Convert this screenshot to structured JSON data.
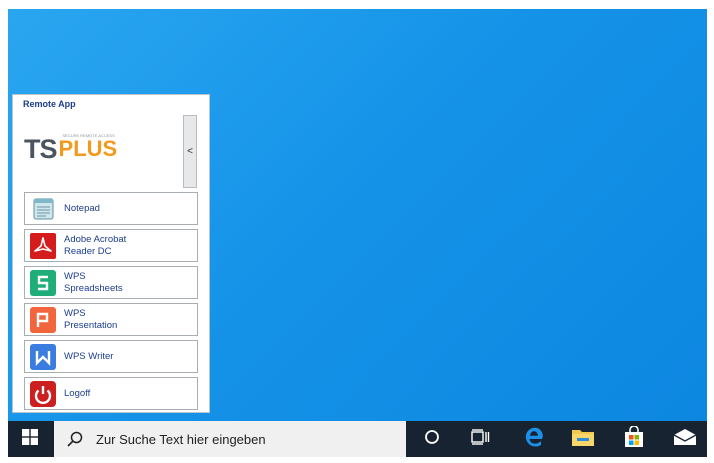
{
  "panel": {
    "title": "Remote App",
    "logo": {
      "ts": "TS",
      "plus": "PLUS",
      "tagline": "SECURE REMOTE ACCESS"
    },
    "collapse_label": "<",
    "apps": [
      {
        "line1": "Notepad",
        "line2": "",
        "icon": "notepad-icon"
      },
      {
        "line1": "Adobe Acrobat",
        "line2": "Reader DC",
        "icon": "adobe-acrobat-icon"
      },
      {
        "line1": "WPS",
        "line2": "Spreadsheets",
        "icon": "wps-spreadsheets-icon"
      },
      {
        "line1": "WPS",
        "line2": "Presentation",
        "icon": "wps-presentation-icon"
      },
      {
        "line1": "WPS Writer",
        "line2": "",
        "icon": "wps-writer-icon"
      },
      {
        "line1": "Logoff",
        "line2": "",
        "icon": "logoff-icon"
      }
    ]
  },
  "taskbar": {
    "search_placeholder": "Zur Suche Text hier eingeben",
    "icons": [
      "windows-start-icon",
      "search-icon",
      "cortana-icon",
      "task-view-icon",
      "edge-icon",
      "file-explorer-icon",
      "store-icon",
      "mail-icon"
    ]
  },
  "colors": {
    "desktop": "#1593e8",
    "taskbar": "#172330",
    "panel_title": "#1c3d8c",
    "logo_orange": "#f39a1e",
    "logo_gray": "#4a5560"
  }
}
